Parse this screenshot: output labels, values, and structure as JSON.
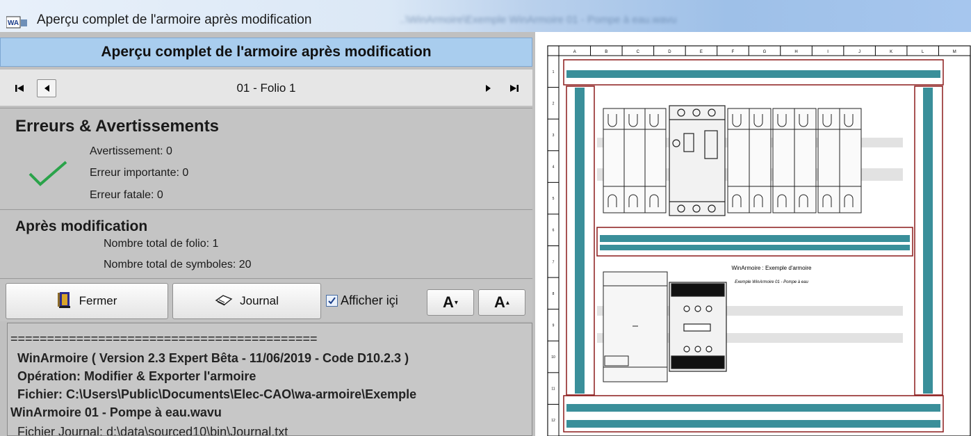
{
  "window": {
    "title": "Aperçu complet de l'armoire après modification",
    "background_blur_text": "..\\WinArmoire\\Exemple WinArmoire 01 - Pompe à eau.wavu"
  },
  "panel": {
    "header": "Aperçu complet de l'armoire après modification",
    "nav": {
      "first_icon": "skip-first-icon",
      "prev_icon": "prev-icon",
      "next_icon": "next-icon",
      "last_icon": "skip-last-icon",
      "folio_label": "01 - Folio 1"
    },
    "errors": {
      "title": "Erreurs & Avertissements",
      "warning": "Avertissement: 0",
      "important": "Erreur importante: 0",
      "fatal": "Erreur fatale: 0",
      "status_icon": "checkmark-icon",
      "status_color": "#2aa34a"
    },
    "after": {
      "title": "Après modification",
      "folio_count": "Nombre total de folio: 1",
      "symbol_count": "Nombre total de symboles: 20"
    },
    "toolbar": {
      "close_label": "Fermer",
      "close_icon": "door-exit-icon",
      "journal_label": "Journal",
      "journal_icon": "book-icon",
      "show_here_label": "Afficher içi",
      "show_here_checked": true,
      "font_smaller_icon": "font-decrease-icon",
      "font_larger_icon": "font-increase-icon"
    },
    "log": {
      "lines": [
        "==========================================",
        "WinArmoire ( Version 2.3 Expert Bêta  - 11/06/2019 - Code D10.2.3 )",
        "Opération: Modifier & Exporter l'armoire",
        "Fichier: C:\\Users\\Public\\Documents\\Elec-CAO\\wa-armoire\\Exemple",
        "WinArmoire 01 - Pompe à eau.wavu",
        "Fichier Journal: d:\\data\\sourced10\\bin\\Journal.txt"
      ]
    }
  },
  "drawing": {
    "columns": [
      "A",
      "B",
      "C",
      "D",
      "E",
      "F",
      "G",
      "H",
      "I",
      "J",
      "K",
      "L",
      "M"
    ],
    "rows": [
      "1",
      "2",
      "3",
      "4",
      "5",
      "6",
      "7",
      "8",
      "9",
      "10",
      "11",
      "12"
    ],
    "title": "WinArmoire : Exemple d'armoire",
    "subtitle": "Exemple WinArmoire 01 - Pompe à eau",
    "rail_color": "#3a8f9a",
    "frame_color": "#8b1a1a"
  }
}
